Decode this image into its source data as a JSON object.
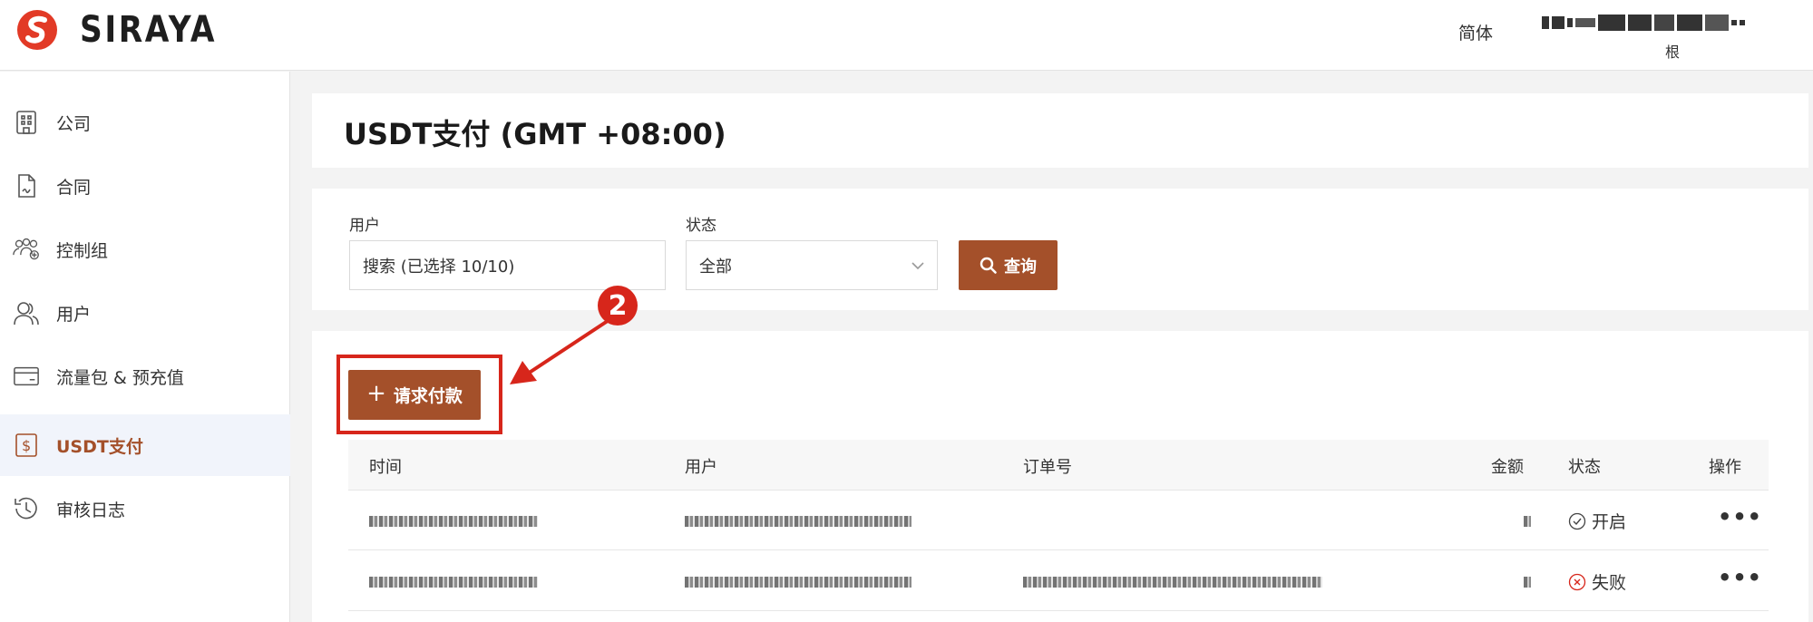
{
  "app": {
    "brand": "SIRAYA"
  },
  "header": {
    "language": "简体",
    "user_role": "根"
  },
  "sidebar": {
    "items": [
      {
        "label": "公司",
        "icon": "building-icon"
      },
      {
        "label": "合同",
        "icon": "contract-icon"
      },
      {
        "label": "控制组",
        "icon": "group-icon"
      },
      {
        "label": "用户",
        "icon": "user-icon"
      },
      {
        "label": "流量包 & 预充值",
        "icon": "card-icon"
      },
      {
        "label": "USDT支付",
        "icon": "dollar-icon",
        "active": true
      },
      {
        "label": "审核日志",
        "icon": "history-icon"
      }
    ]
  },
  "page": {
    "title": "USDT支付 (GMT +08:00)"
  },
  "filters": {
    "user_label": "用户",
    "user_value": "搜索 (已选择 10/10)",
    "status_label": "状态",
    "status_value": "全部",
    "query_label": "查询"
  },
  "actions": {
    "request_payment_label": "请求付款",
    "step_badge": "2"
  },
  "table": {
    "columns": [
      "时间",
      "用户",
      "订单号",
      "金额",
      "状态",
      "操作"
    ],
    "rows": [
      {
        "status": "开启"
      },
      {
        "status": "失败"
      }
    ]
  },
  "colors": {
    "accent": "#a4502a",
    "highlight": "#d7261b",
    "active_bg": "#f1f4fb"
  }
}
